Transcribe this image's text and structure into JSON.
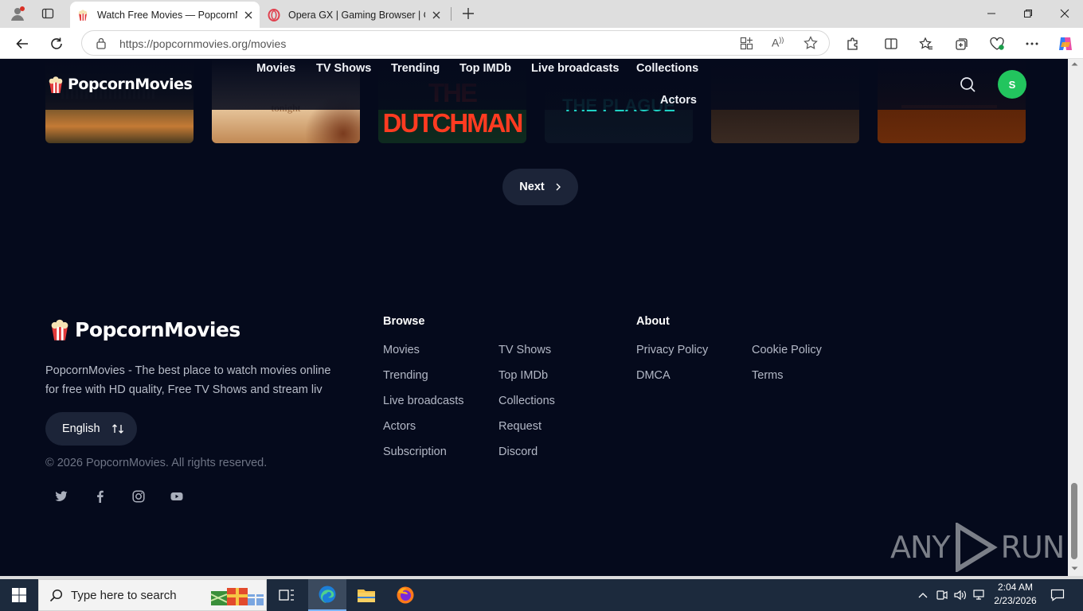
{
  "browser": {
    "tabs": [
      {
        "title": "Watch Free Movies — PopcornMo",
        "active": true
      },
      {
        "title": "Opera GX | Gaming Browser | Ope",
        "active": false
      }
    ],
    "address": {
      "url": "https://popcornmovies.org/movies"
    }
  },
  "site": {
    "logo_text": "PopcornMovies",
    "nav": [
      "Movies",
      "TV Shows",
      "Trending",
      "Top IMDb",
      "Live broadcasts",
      "Collections",
      "Actors"
    ],
    "avatar_initial": "S",
    "posters": [
      {
        "text": "",
        "colors": [
          "#3b3a23",
          "#c47a35"
        ]
      },
      {
        "text": "tonight",
        "colors": [
          "#e9c9a0",
          "#c28a55"
        ]
      },
      {
        "text": "THE DUTCHMAN",
        "colors": [
          "#0e2a1f",
          "#143226"
        ]
      },
      {
        "text": "THE PLAGUE",
        "colors": [
          "#0a0f1f",
          "#0d1626"
        ]
      },
      {
        "text": "",
        "colors": [
          "#2b1f1a",
          "#3a2a22"
        ]
      },
      {
        "text": "",
        "colors": [
          "#5a2308",
          "#6b2c0a"
        ]
      }
    ],
    "pagination": {
      "next_label": "Next"
    },
    "footer": {
      "description": [
        "PopcornMovies - The best place to watch movies online",
        "for free with HD quality, Free TV Shows and stream liv"
      ],
      "language": "English",
      "copyright": "© 2026 PopcornMovies. All rights reserved.",
      "browse_title": "Browse",
      "browse_links": [
        "Movies",
        "TV Shows",
        "Trending",
        "Top IMDb",
        "Live broadcasts",
        "Collections",
        "Actors",
        "Request",
        "Subscription",
        "Discord"
      ],
      "about_title": "About",
      "about_links": [
        "Privacy Policy",
        "Cookie Policy",
        "DMCA",
        "Terms"
      ],
      "social": [
        "twitter-icon",
        "facebook-icon",
        "instagram-icon",
        "youtube-icon"
      ]
    },
    "watermark": {
      "left": "ANY",
      "right": "RUN"
    }
  },
  "taskbar": {
    "search_placeholder": "Type here to search",
    "time": "2:04 AM",
    "date": "2/23/2026"
  }
}
